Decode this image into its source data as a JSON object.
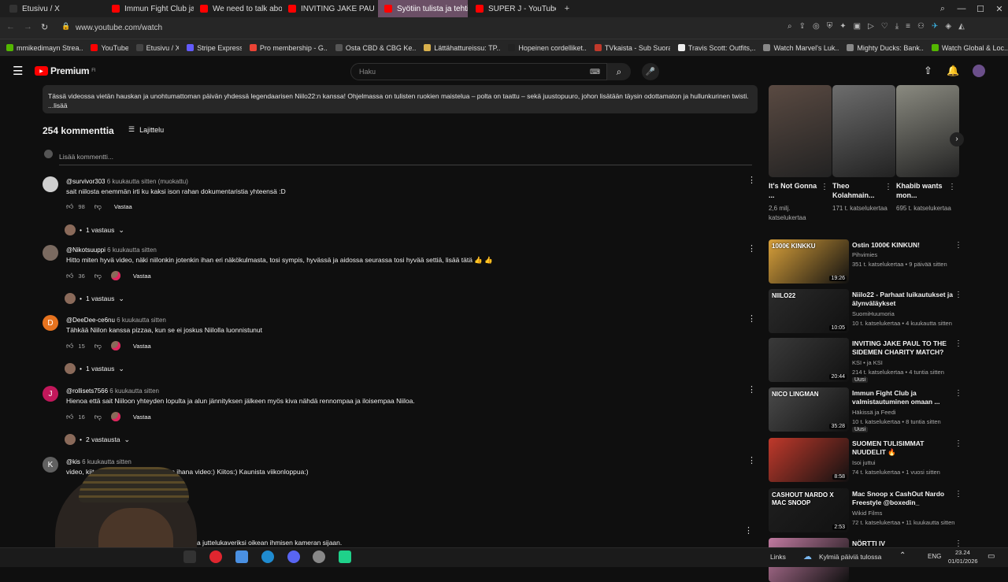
{
  "browser": {
    "tabs": [
      {
        "label": "Etusivu / X",
        "color": "#333333"
      },
      {
        "label": "Immun Fight Club ja valm",
        "color": "#ff0000"
      },
      {
        "label": "We need to talk about thi",
        "color": "#ff0000"
      },
      {
        "label": "INVITING JAKE PAUL TO T",
        "color": "#ff0000"
      },
      {
        "label": "Syötiin tulista ja tehtii",
        "color": "#ff0000"
      },
      {
        "label": "SUPER J - YouTube",
        "color": "#ff0000"
      }
    ],
    "url": "www.youtube.com/watch",
    "bookmarks": [
      {
        "label": "mmikedimayn Strea...",
        "color": "#53b600"
      },
      {
        "label": "YouTube",
        "color": "#ff0000"
      },
      {
        "label": "Etusivu / X",
        "color": "#444444"
      },
      {
        "label": "Stripe Express",
        "color": "#635bff"
      },
      {
        "label": "Pro membership - G...",
        "color": "#ea4335"
      },
      {
        "label": "Osta CBD & CBG Ke...",
        "color": "#555555"
      },
      {
        "label": "Lättähattureissu: TP...",
        "color": "#d8b04c"
      },
      {
        "label": "Hopeinen cordelliket...",
        "color": "#222222"
      },
      {
        "label": "TVkaista - Sub Suora",
        "color": "#c0392b"
      },
      {
        "label": "Travis Scott: Outfits,...",
        "color": "#eeeeee"
      },
      {
        "label": "Watch Marvel's Luk...",
        "color": "#888888"
      },
      {
        "label": "Mighty Ducks: Bank...",
        "color": "#888888"
      },
      {
        "label": "Watch Global & Loc...",
        "color": "#53b600"
      }
    ]
  },
  "youtube": {
    "logo": "Premium",
    "logo_sup": "FI",
    "search_placeholder": "Haku"
  },
  "description": {
    "line1": "Tässä videossa vietän hauskan ja unohtumattoman päivän yhdessä legendaarisen Niilo22:n kanssa! Ohjelmassa on tulisten ruokien maistelua – polta on taattu – sekä juustopuuro, johon lisätään täysin odottamaton ja hullunkurinen twisti.",
    "more": "...lisää"
  },
  "comments_header": {
    "count": "254 kommenttia",
    "sort": "Lajittelu",
    "add_placeholder": "Lisää kommentti..."
  },
  "comments": [
    {
      "author": "@survivor303",
      "time": "6 kuukautta sitten (muokattu)",
      "text": "sait niilosta enemmän irti ku kaksi ison rahan dokumentaristia yhteensä :D",
      "likes": "98",
      "reply": "Vastaa",
      "replies": "1 vastaus",
      "avatar_color": "#cfcfcf",
      "avatar_letter": "",
      "creator_heart": false
    },
    {
      "author": "@Nikotsuuppi",
      "time": "6 kuukautta sitten",
      "text": "Hitto miten hyvä video, näki niilonkin jotenkin ihan eri näkökulmasta, tosi sympis, hyvässä ja aidossa seurassa tosi hyvää settiä, lisää tätä 👍 👍",
      "likes": "36",
      "reply": "Vastaa",
      "replies": "1 vastaus",
      "avatar_color": "#7a6a60",
      "avatar_letter": "",
      "creator_heart": true
    },
    {
      "author": "@DeeDee-ce6nu",
      "time": "6 kuukautta sitten",
      "text": "Tähkää Niilon kanssa pizzaa, kun se ei joskus Niilolla  luonnistunut",
      "likes": "15",
      "reply": "Vastaa",
      "replies": "1 vastaus",
      "avatar_color": "#e6731f",
      "avatar_letter": "D",
      "creator_heart": true
    },
    {
      "author": "@rollisets7566",
      "time": "6 kuukautta sitten",
      "text": "Hienoa että sait Niiloon yhteyden lopulta ja alun jännityksen jälkeen myös kiva nähdä rennompaa ja iloisempaa Niiloa.",
      "likes": "16",
      "reply": "Vastaa",
      "replies": "2 vastausta",
      "avatar_color": "#c2185b",
      "avatar_letter": "J",
      "creator_heart": true
    },
    {
      "author": "@kis",
      "time": "6 kuukautta sitten",
      "text": "video, kiitos teille molemmille:) Aivan ihana video:) Kiitos:) Kaunista viikonloppua:)",
      "likes": "",
      "reply": "",
      "replies": "",
      "avatar_color": "#606060",
      "avatar_letter": "K",
      "creator_heart": false
    }
  ],
  "last_comment_fragment": "saa juttelukaveriksi oikean ihmisen kameran sijaan.",
  "shorts": [
    {
      "title": "It's Not Gonna ...",
      "views": "2,6 milj. katselukertaa",
      "color": "#5a4a42"
    },
    {
      "title": "Theo Kolahmain...",
      "views": "171 t. katselukertaa",
      "color": "#6d6d6d"
    },
    {
      "title": "Khabib wants mon...",
      "views": "695 t. katselukertaa",
      "color": "#8a8a80"
    }
  ],
  "recommendations": [
    {
      "title": "Ostin 1000€ KINKUN!",
      "channel": "Pihvimies",
      "meta": "351 t. katselukertaa • 9 päivää sitten",
      "duration": "19:26",
      "thumb_text": "1000€ KINKKU",
      "color": "#d8a03a",
      "badge": ""
    },
    {
      "title": "Niilo22 - Parhaat luikautukset ja älynväläykset",
      "channel": "SuomiHuumoria",
      "meta": "10 t. katselukertaa • 4 kuukautta sitten",
      "duration": "10:05",
      "thumb_text": "NIILO22",
      "color": "#2b2b2b",
      "badge": ""
    },
    {
      "title": "INVITING JAKE PAUL TO THE SIDEMEN CHARITY MATCH?",
      "channel": "KSI • ja KSI",
      "meta": "214 t. katselukertaa • 4 tuntia sitten",
      "duration": "20:44",
      "thumb_text": "",
      "color": "#3a3a3a",
      "badge": "Uusi"
    },
    {
      "title": "Immun Fight Club ja valmistautuminen omaan ...",
      "channel": "Häkissä ja Feedi",
      "meta": "10 t. katselukertaa • 8 tuntia sitten",
      "duration": "35:28",
      "thumb_text": "NICO LINGMAN",
      "color": "#4a4a4a",
      "badge": "Uusi"
    },
    {
      "title": "SUOMEN TULISIMMAT NUUDELIT 🔥",
      "channel": "Isoi juttui",
      "meta": "74 t. katselukertaa • 1 vuosi sitten",
      "duration": "8:58",
      "thumb_text": "",
      "color": "#c0392b",
      "badge": ""
    },
    {
      "title": "Mac Snoop x CashOut Nardo Freestyle @boxedin_",
      "channel": "Wikid Films",
      "meta": "72 t. katselukertaa • 11 kuukautta sitten",
      "duration": "2:53",
      "thumb_text": "CASHOUT NARDO X MAC SNOOP",
      "color": "#1f1f1f",
      "badge": ""
    },
    {
      "title": "NÖRTTI IV",
      "channel": "",
      "meta": "",
      "duration": "",
      "thumb_text": "",
      "color": "#c07aa0",
      "badge": ""
    }
  ],
  "taskbar": {
    "links": "Links",
    "weather": "Kylmiä päiviä tulossa",
    "lang": "ENG",
    "time": "23.24",
    "date": "01/01/2026"
  }
}
